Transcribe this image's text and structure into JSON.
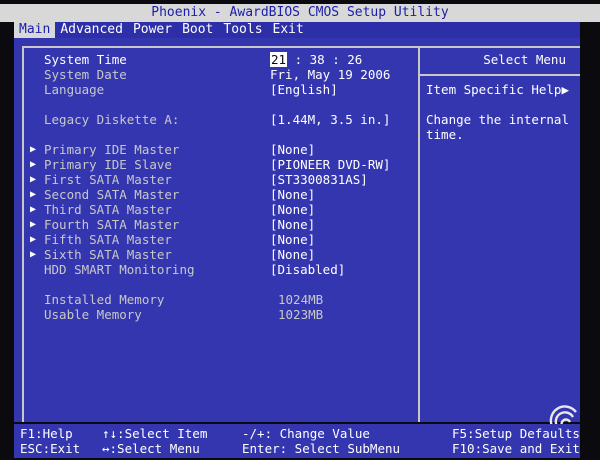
{
  "titlebar": {
    "text": "Phoenix - AwardBIOS CMOS Setup Utility"
  },
  "menu": [
    "Main",
    "Advanced",
    "Power",
    "Boot",
    "Tools",
    "Exit"
  ],
  "main": {
    "system_time": {
      "label": "System Time",
      "hour": "21",
      "rest": " : 38 : 26"
    },
    "system_date": {
      "label": "System Date",
      "value": "Fri, May 19 2006"
    },
    "language": {
      "label": "Language",
      "value": "[English]"
    },
    "legacy_diskette": {
      "label": "Legacy Diskette A:",
      "value": "[1.44M, 3.5 in.]"
    },
    "drives": [
      {
        "label": "Primary IDE Master",
        "value": "[None]"
      },
      {
        "label": "Primary IDE Slave",
        "value": "[PIONEER DVD-RW]"
      },
      {
        "label": "First SATA Master",
        "value": "[ST3300831AS]"
      },
      {
        "label": "Second SATA Master",
        "value": "[None]"
      },
      {
        "label": "Third SATA Master",
        "value": "[None]"
      },
      {
        "label": "Fourth SATA Master",
        "value": "[None]"
      },
      {
        "label": "Fifth SATA Master",
        "value": "[None]"
      },
      {
        "label": "Sixth SATA Master",
        "value": "[None]"
      }
    ],
    "hdd_smart": {
      "label": "HDD SMART Monitoring",
      "value": "[Disabled]"
    },
    "installed_memory": {
      "label": "Installed Memory",
      "value": "1024MB"
    },
    "usable_memory": {
      "label": "Usable Memory",
      "value": "1023MB"
    }
  },
  "help": {
    "select_menu": "Select Menu",
    "item_specific": "Item Specific Help▶",
    "text": "Change the internal\ntime."
  },
  "footer": {
    "f1": "F1:Help",
    "esc": "ESC:Exit",
    "select_item": "↑↓:Select Item",
    "select_menu": "↔:Select Menu",
    "change_value": "-/+: Change Value",
    "enter": "Enter: Select SubMenu",
    "f5": "F5:Setup Defaults",
    "f10": "F10:Save and Exit"
  },
  "colors": {
    "panel": "#3436b0",
    "text": "#ffffff",
    "dim": "#c8c8c8",
    "title": "#1b1ea8"
  }
}
